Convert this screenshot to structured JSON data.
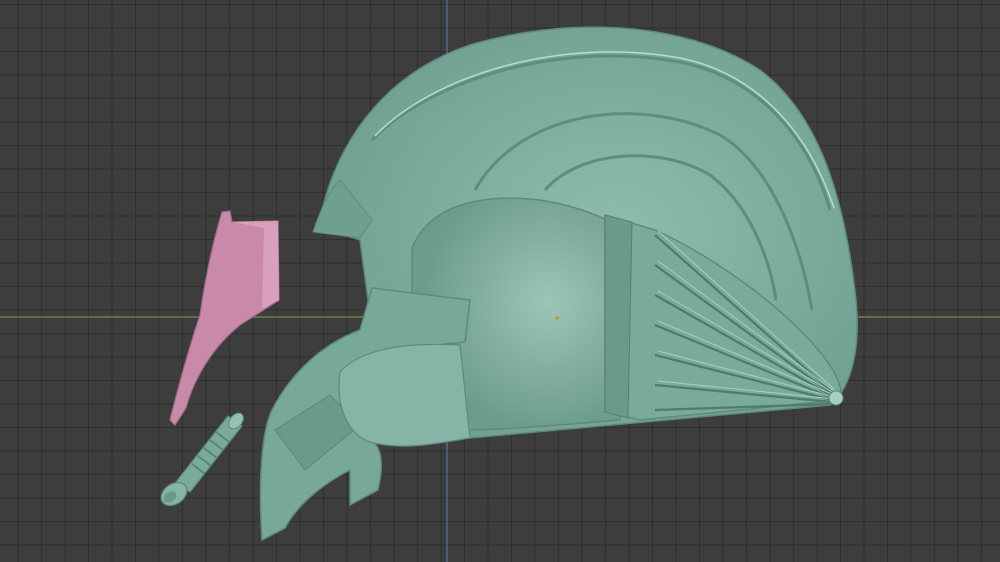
{
  "viewport": {
    "background_color": "#3d3d3d",
    "grid_line_color": "#333333",
    "x_axis_color": "#7d8b3a",
    "y_axis_color": "#5a6fa8"
  },
  "scene": {
    "objects": [
      {
        "name": "helmet-shell",
        "color": "#7aaa9c",
        "selected": false
      },
      {
        "name": "face-plate-piece",
        "color": "#c98aaa",
        "selected": false
      },
      {
        "name": "tube-rod-piece",
        "color": "#7aaa9c",
        "selected": false
      }
    ],
    "origin_marker_color": "#b8a020"
  }
}
